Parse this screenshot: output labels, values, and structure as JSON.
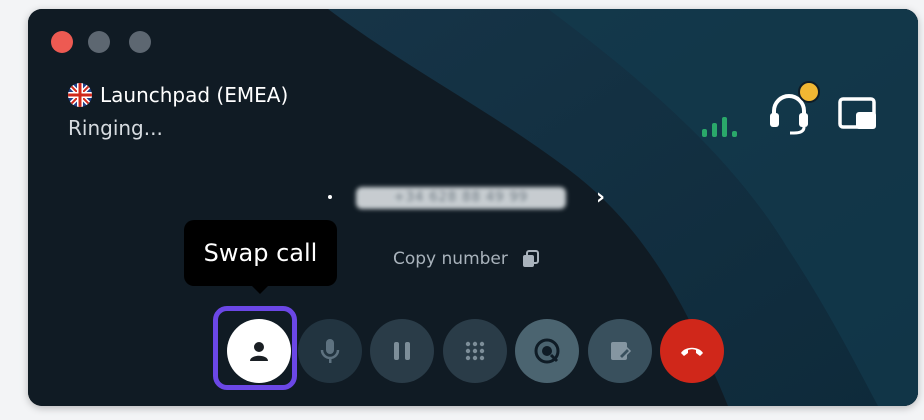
{
  "window": {
    "controls": [
      "close",
      "minimize",
      "maximize"
    ]
  },
  "call": {
    "line_name": "Launchpad (EMEA)",
    "line_flag_icon": "uk-flag-icon",
    "status": "Ringing...",
    "number_masked": "+34 628 88 49 99",
    "copy_label": "Copy number"
  },
  "header_icons": {
    "signal": "signal-strength-icon",
    "headset": "headset-icon",
    "headset_badge_color": "#f1b733",
    "pip": "picture-in-picture-icon"
  },
  "tooltip": {
    "text": "Swap call"
  },
  "controls": [
    {
      "name": "swap-call",
      "icon": "person-icon",
      "active": true
    },
    {
      "name": "mute",
      "icon": "microphone-icon"
    },
    {
      "name": "hold",
      "icon": "pause-icon"
    },
    {
      "name": "keypad",
      "icon": "dialpad-icon"
    },
    {
      "name": "record",
      "icon": "record-icon"
    },
    {
      "name": "notes",
      "icon": "note-icon"
    },
    {
      "name": "hang-up",
      "icon": "hang-up-icon"
    }
  ],
  "colors": {
    "accent": "#6b47e6",
    "hangup": "#d0271a",
    "signal": "#2aa86a"
  }
}
